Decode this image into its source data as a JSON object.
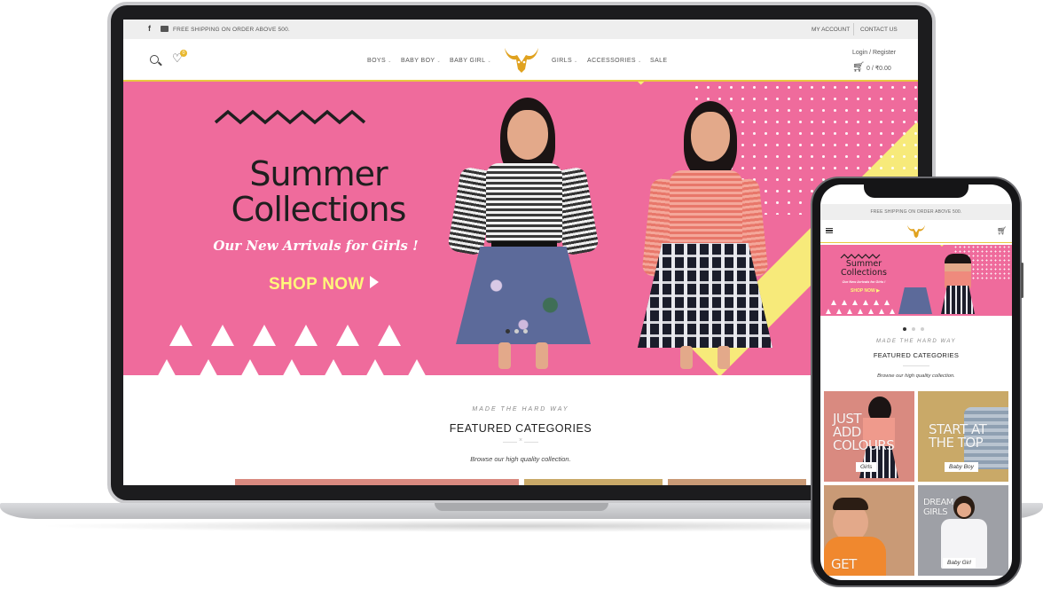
{
  "desktop": {
    "topbar": {
      "facebook_icon": "facebook-icon",
      "mail_icon": "mail-icon",
      "shipping_text": "FREE SHIPPING ON ORDER ABOVE 500.",
      "my_account": "MY ACCOUNT",
      "contact_us": "CONTACT US"
    },
    "header": {
      "nav_left": [
        "BOYS",
        "BABY BOY",
        "BABY GIRL"
      ],
      "nav_right": [
        "GIRLS",
        "ACCESSORIES",
        "SALE"
      ],
      "wishlist_count": "0",
      "login_register": "Login / Register",
      "cart_total": "0 / ₹0.00",
      "chevron": "⌄"
    },
    "hero": {
      "title_line1": "Summer",
      "title_line2": "Collections",
      "subtitle": "Our New Arrivals for Girls !",
      "cta": "SHOP NOW",
      "slides": 3,
      "active_slide": 0
    },
    "section": {
      "eyebrow": "MADE THE HARD WAY",
      "title": "FEATURED CATEGORIES",
      "divider_mark": "×",
      "subtitle": "Browse our high quality collection."
    }
  },
  "mobile": {
    "topbar_text": "FREE SHIPPING ON ORDER ABOVE 500.",
    "hero": {
      "title_line1": "Summer",
      "title_line2": "Collections",
      "subtitle": "Our New Arrivals for Girls !",
      "cta": "SHOP NOW ▶"
    },
    "section": {
      "eyebrow": "MADE THE HARD WAY",
      "title": "FEATURED CATEGORIES",
      "subtitle": "Browse our high quality collection."
    },
    "tiles": [
      {
        "text_line1": "JUST",
        "text_line2": "ADD",
        "text_line3": "COLOURS",
        "label": "Girls",
        "bg": "#d98a80"
      },
      {
        "text_line1": "START AT",
        "text_line2": "THE TOP",
        "text_line3": "",
        "label": "Baby Boy",
        "bg": "#c9a968"
      },
      {
        "text_line1": "",
        "text_line2": "",
        "text_line3": "GET",
        "label": "",
        "bg": "#c99a76"
      },
      {
        "text_line1": "DREAM",
        "text_line2": "GIRLS",
        "text_line3": "",
        "label": "Baby Girl",
        "bg": "#9ea0a6"
      }
    ]
  },
  "colors": {
    "hero_pink": "#ef6b9c",
    "hero_yellow": "#f7ea7a",
    "accent_gold": "#e8b72c"
  }
}
